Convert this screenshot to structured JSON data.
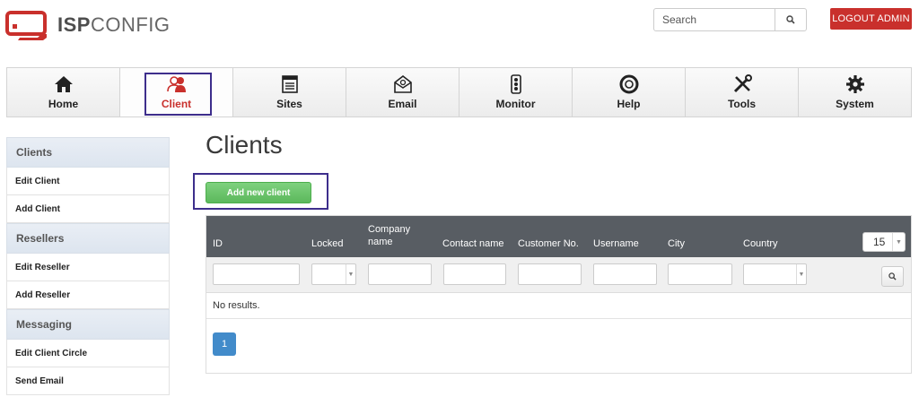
{
  "header": {
    "logo_bold": "ISP",
    "logo_thin": "CONFIG",
    "search_placeholder": "Search",
    "logout_label": "LOGOUT ADMIN",
    "brand_color": "#c9302c"
  },
  "topnav": {
    "tabs": [
      {
        "label": "Home",
        "icon": "home-icon"
      },
      {
        "label": "Client",
        "icon": "client-icon",
        "active": true
      },
      {
        "label": "Sites",
        "icon": "sites-icon"
      },
      {
        "label": "Email",
        "icon": "email-icon"
      },
      {
        "label": "Monitor",
        "icon": "monitor-icon"
      },
      {
        "label": "Help",
        "icon": "help-icon"
      },
      {
        "label": "Tools",
        "icon": "tools-icon"
      },
      {
        "label": "System",
        "icon": "system-icon"
      }
    ]
  },
  "sidebar": {
    "sections": [
      {
        "title": "Clients",
        "items": [
          "Edit Client",
          "Add Client"
        ]
      },
      {
        "title": "Resellers",
        "items": [
          "Edit Reseller",
          "Add Reseller"
        ]
      },
      {
        "title": "Messaging",
        "items": [
          "Edit Client Circle",
          "Send Email"
        ]
      }
    ]
  },
  "main": {
    "title": "Clients",
    "add_button": "Add new client",
    "table": {
      "columns": [
        {
          "id": "id",
          "label": "ID"
        },
        {
          "id": "locked",
          "label": "Locked"
        },
        {
          "id": "company",
          "label": "Company name"
        },
        {
          "id": "contact",
          "label": "Contact name"
        },
        {
          "id": "customer_no",
          "label": "Customer No."
        },
        {
          "id": "username",
          "label": "Username"
        },
        {
          "id": "city",
          "label": "City"
        },
        {
          "id": "country",
          "label": "Country"
        }
      ],
      "per_page": "15",
      "empty_text": "No results.",
      "current_page": "1"
    }
  }
}
